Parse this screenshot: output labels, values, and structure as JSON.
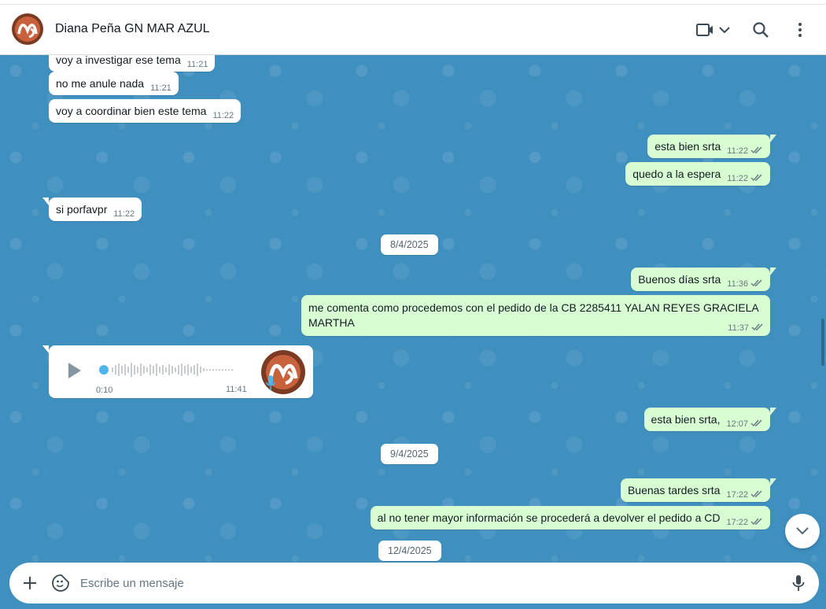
{
  "header": {
    "contact_name": "Diana Peña GN MAR AZUL",
    "avatar_icon": "contact-avatar",
    "icons": [
      "video-call-icon",
      "chevron-down-icon",
      "search-icon",
      "more-vertical-icon"
    ]
  },
  "messages": [
    {
      "dir": "in",
      "text": "voy a investigar ese tema",
      "time": "11:21"
    },
    {
      "dir": "in",
      "text": "no me anule nada",
      "time": "11:21"
    },
    {
      "dir": "in",
      "text": "voy a coordinar bien este tema",
      "time": "11:22"
    },
    {
      "dir": "out",
      "text": "esta bien srta",
      "time": "11:22",
      "status": "read"
    },
    {
      "dir": "out",
      "text": "quedo a la espera",
      "time": "11:22",
      "status": "read"
    },
    {
      "dir": "in",
      "text": "si porfavpr",
      "time": "11:22"
    },
    {
      "dir": "date",
      "text": "8/4/2025"
    },
    {
      "dir": "out",
      "text": "Buenos días srta",
      "time": "11:36",
      "status": "read"
    },
    {
      "dir": "out",
      "text_line1": "me comenta como procedemos con el pedido de la CB 2285411 YALAN REYES GRACIELA",
      "text_line2": "MARTHA",
      "time": "11:37",
      "status": "read"
    },
    {
      "dir": "in",
      "type": "audio",
      "duration": "0:10",
      "time": "11:41"
    },
    {
      "dir": "out",
      "text": "esta bien srta,",
      "time": "12:07",
      "status": "read"
    },
    {
      "dir": "date",
      "text": "9/4/2025"
    },
    {
      "dir": "out",
      "text": "Buenas tardes srta",
      "time": "17:22",
      "status": "read"
    },
    {
      "dir": "out",
      "text": "al no tener mayor información se procederá a devolver el pedido a CD",
      "time": "17:22",
      "status": "read"
    },
    {
      "dir": "date",
      "text": "12/4/2025"
    }
  ],
  "composer": {
    "placeholder": "Escribe un mensaje",
    "icons": [
      "plus-icon",
      "sticker-icon",
      "microphone-icon"
    ]
  },
  "colors": {
    "chat_bg": "#3f8fbf",
    "incoming": "#ffffff",
    "outgoing": "#d9fdd3",
    "read_ticks": "#667781"
  }
}
